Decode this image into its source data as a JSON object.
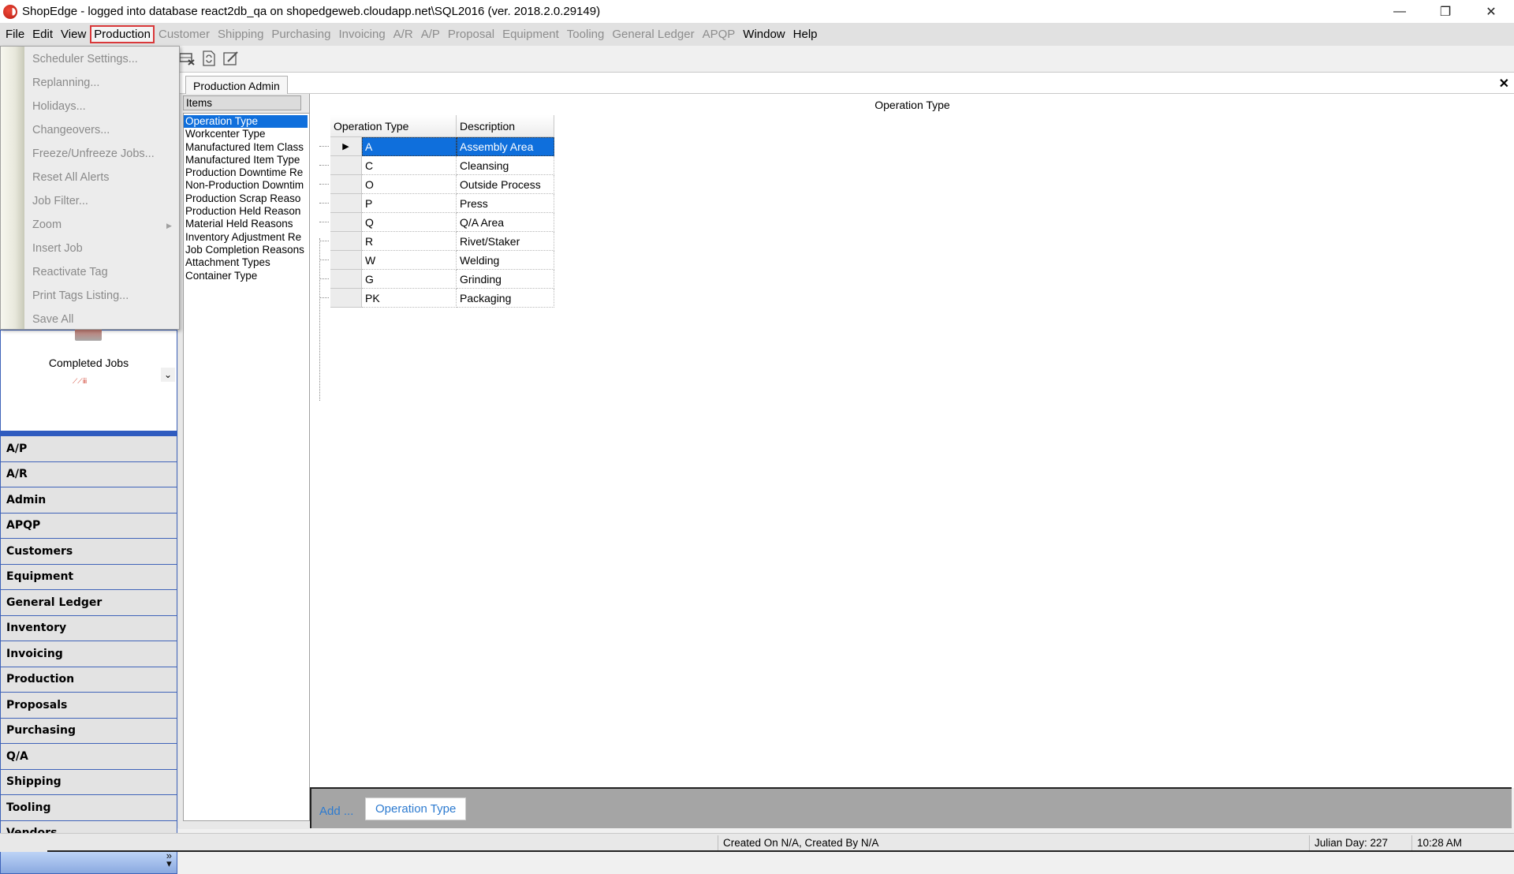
{
  "window": {
    "title": "ShopEdge -  logged into database react2db_qa on shopedgeweb.cloudapp.net\\SQL2016 (ver. 2018.2.0.29149)",
    "controls": {
      "minimize": "—",
      "restore": "❐",
      "close": "✕"
    }
  },
  "menubar": {
    "items": [
      {
        "label": "File",
        "state": "enabled"
      },
      {
        "label": "Edit",
        "state": "enabled"
      },
      {
        "label": "View",
        "state": "enabled"
      },
      {
        "label": "Production",
        "state": "active"
      },
      {
        "label": "Customer",
        "state": "disabled"
      },
      {
        "label": "Shipping",
        "state": "disabled"
      },
      {
        "label": "Purchasing",
        "state": "disabled"
      },
      {
        "label": "Invoicing",
        "state": "disabled"
      },
      {
        "label": "A/R",
        "state": "disabled"
      },
      {
        "label": "A/P",
        "state": "disabled"
      },
      {
        "label": "Proposal",
        "state": "disabled"
      },
      {
        "label": "Equipment",
        "state": "disabled"
      },
      {
        "label": "Tooling",
        "state": "disabled"
      },
      {
        "label": "General Ledger",
        "state": "disabled"
      },
      {
        "label": "APQP",
        "state": "disabled"
      },
      {
        "label": "Window",
        "state": "enabled"
      },
      {
        "label": "Help",
        "state": "enabled"
      }
    ],
    "highlight_color": "#d9383a"
  },
  "production_menu": {
    "items": [
      {
        "label": "Scheduler Settings...",
        "submenu": false
      },
      {
        "label": "Replanning...",
        "submenu": false
      },
      {
        "label": "Holidays...",
        "submenu": false
      },
      {
        "label": "Changeovers...",
        "submenu": false
      },
      {
        "label": "Freeze/Unfreeze Jobs...",
        "submenu": false
      },
      {
        "label": "Reset All Alerts",
        "submenu": false
      },
      {
        "label": "Job Filter...",
        "submenu": false
      },
      {
        "label": "Zoom",
        "submenu": true
      },
      {
        "label": "Insert Job",
        "submenu": false
      },
      {
        "label": "Reactivate Tag",
        "submenu": false
      },
      {
        "label": "Print Tags Listing...",
        "submenu": false
      },
      {
        "label": "Save All",
        "submenu": false
      }
    ],
    "submenu_arrow": "▶"
  },
  "toolbar": {
    "icons": [
      "grid-delete-icon",
      "refresh-document-icon",
      "edit-document-icon"
    ]
  },
  "navpane": {
    "header_label": "Completed Jobs",
    "chevron": "⌄",
    "buttons": [
      "A/P",
      "A/R",
      "Admin",
      "APQP",
      "Customers",
      "Equipment",
      "General Ledger",
      "Inventory",
      "Invoicing",
      "Production",
      "Proposals",
      "Purchasing",
      "Q/A",
      "Shipping",
      "Tooling",
      "Vendors"
    ],
    "overflow_icon": "»",
    "accent_color": "#3f63b9"
  },
  "tabs": {
    "active": "Production Admin",
    "close": "✕"
  },
  "items_panel": {
    "header": "Items",
    "items": [
      "Operation Type",
      "Workcenter Type",
      "Manufactured Item Class",
      "Manufactured Item Type",
      "Production Downtime Re",
      "Non-Production Downtim",
      "Production Scrap Reaso",
      "Production Held Reason",
      "Material Held Reasons",
      "Inventory Adjustment Re",
      "Job Completion Reasons",
      "Attachment Types",
      "Container Type"
    ],
    "selected_index": 0,
    "selection_color": "#0f6fdc"
  },
  "main": {
    "title": "Operation Type",
    "grid": {
      "columns": [
        "Operation Type",
        "Description"
      ],
      "rows": [
        {
          "code": "A",
          "description": "Assembly Area",
          "selected": true
        },
        {
          "code": "C",
          "description": "Cleansing",
          "selected": false
        },
        {
          "code": "O",
          "description": "Outside Process",
          "selected": false
        },
        {
          "code": "P",
          "description": "Press",
          "selected": false
        },
        {
          "code": "Q",
          "description": "Q/A Area",
          "selected": false
        },
        {
          "code": "R",
          "description": "Rivet/Staker",
          "selected": false
        },
        {
          "code": "W",
          "description": "Welding",
          "selected": false
        },
        {
          "code": "G",
          "description": "Grinding",
          "selected": false
        },
        {
          "code": "PK",
          "description": "Packaging",
          "selected": false
        }
      ],
      "current_row_marker": "▶"
    }
  },
  "action_bar": {
    "add_label": "Add ...",
    "button_label": "Operation Type",
    "link_color": "#2d7bd0"
  },
  "statusbar": {
    "created": "Created On N/A, Created By N/A",
    "julian_day": "Julian Day: 227",
    "time": "10:28 AM"
  }
}
